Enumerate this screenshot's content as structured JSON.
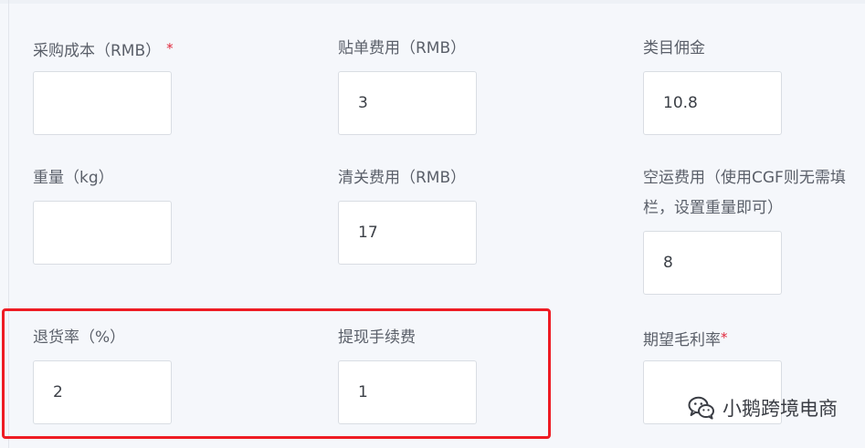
{
  "fields": {
    "purchase_cost": {
      "label": "采购成本（RMB）",
      "required_mark": "*",
      "value": ""
    },
    "labeling_fee": {
      "label": "贴单费用（RMB）",
      "value": "3"
    },
    "category_commission": {
      "label": "类目佣金",
      "value": "10.8"
    },
    "weight": {
      "label": "重量（kg）",
      "value": ""
    },
    "customs_fee": {
      "label": "清关费用（RMB）",
      "value": "17"
    },
    "air_freight": {
      "label": "空运费用（使用CGF则无需填栏，设置重量即可）",
      "value": "8"
    },
    "return_rate": {
      "label": "退货率（%）",
      "value": "2"
    },
    "withdrawal_fee": {
      "label": "提现手续费",
      "value": "1"
    },
    "expected_margin": {
      "label": "期望毛利率",
      "required_mark": "*",
      "value": ""
    }
  },
  "watermark": {
    "text": "小鹅跨境电商",
    "icon": "wechat-icon"
  },
  "colors": {
    "highlight": "#ee1c24",
    "required": "#e0283c",
    "background": "#f5f7fb"
  }
}
